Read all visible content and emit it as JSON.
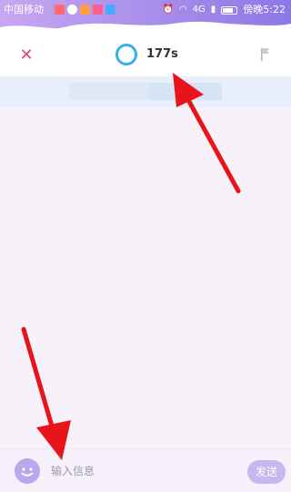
{
  "status_bar": {
    "carrier": "中国移动",
    "network": "4G",
    "time": "傍晚5:22",
    "icons": [
      "notification-icon",
      "message-icon",
      "app-icon",
      "gallery-icon",
      "weather-icon",
      "alarm-icon",
      "wifi-icon",
      "signal-icon",
      "battery-icon"
    ]
  },
  "header": {
    "close_icon": "close-icon",
    "timer_value": "177s",
    "flag_icon": "flag-icon"
  },
  "composer": {
    "emoji_icon": "emoji-icon",
    "placeholder": "输入信息",
    "send_label": "发送"
  },
  "colors": {
    "accent_purple": "#a58ff0",
    "timer_ring": "#3ab0e8",
    "close": "#e0467a",
    "send_button": "#c7b6ef",
    "annotation": "#e8141c"
  }
}
